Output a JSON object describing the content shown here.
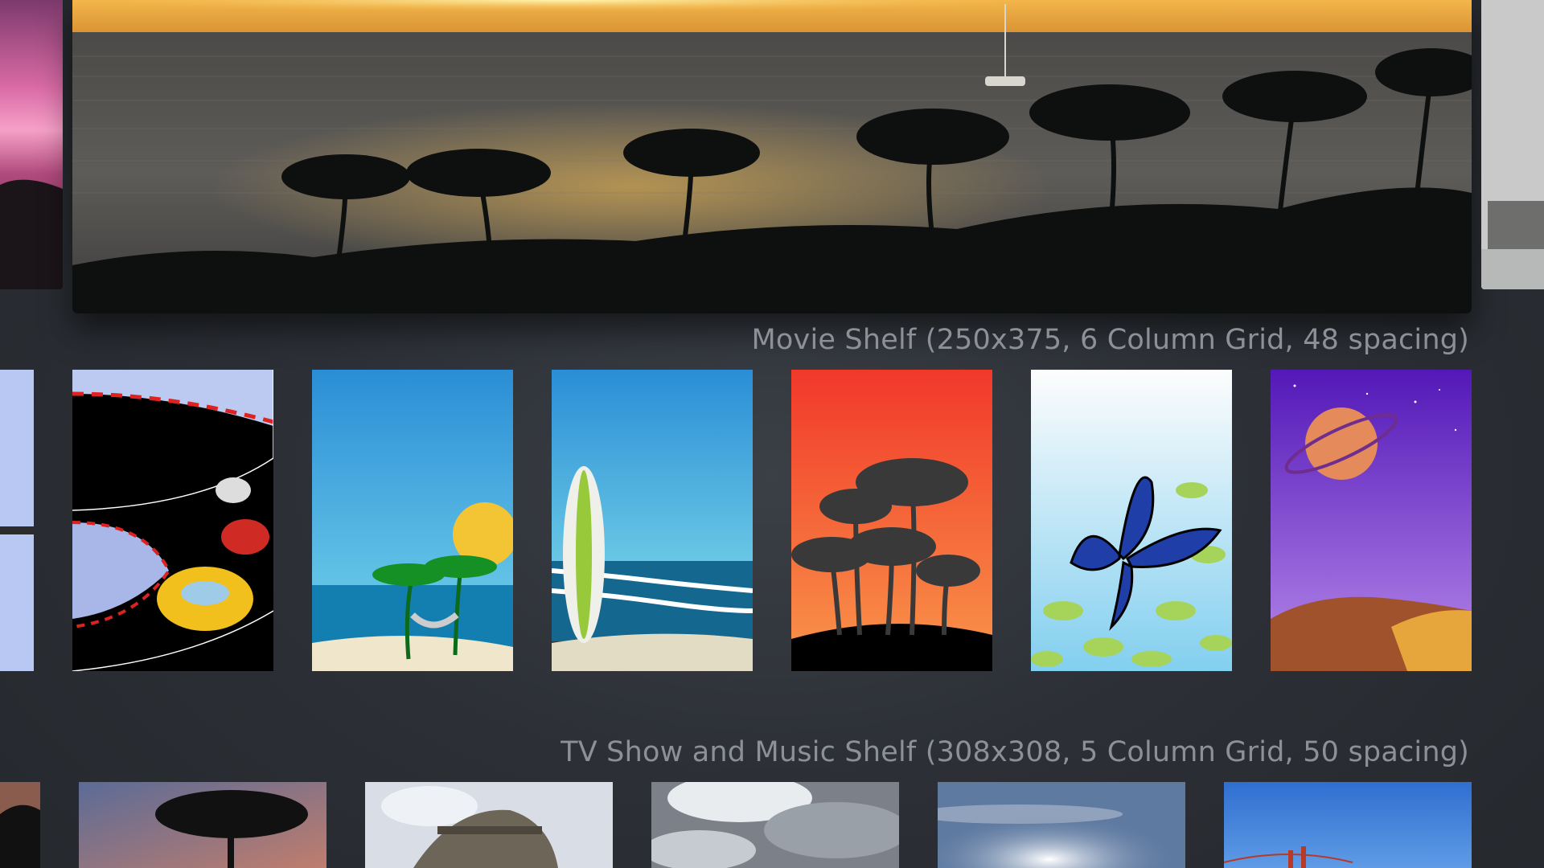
{
  "movie_shelf": {
    "title": "Movie Shelf (250x375, 6 Column Grid, 48 spacing)",
    "posters": [
      "race-car",
      "beach-hammock",
      "surfboard",
      "palm-sunset",
      "butterfly",
      "planet"
    ]
  },
  "tv_shelf": {
    "title": "TV Show and Music Shelf (308x308, 5 Column Grid, 50 spacing)",
    "items": [
      "palm-dusk",
      "waterwheel",
      "clouds",
      "sun-sky",
      "bridge"
    ]
  },
  "colors": {
    "background": "#2b2f35",
    "title_text": "#8d9097"
  }
}
